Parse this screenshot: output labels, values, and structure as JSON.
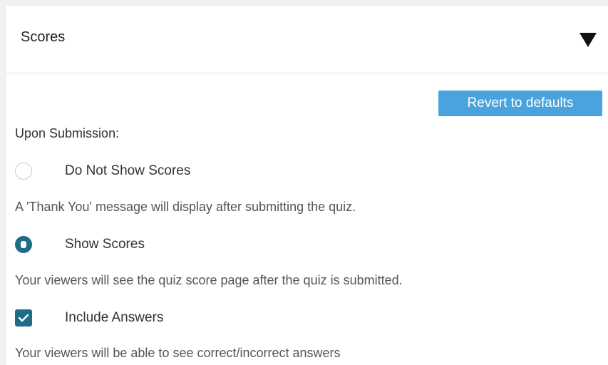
{
  "header": {
    "title": "Scores"
  },
  "actions": {
    "revert_label": "Revert to defaults"
  },
  "submission": {
    "label": "Upon Submission:",
    "options": [
      {
        "label": "Do Not Show Scores",
        "checked": false,
        "description": "A 'Thank You' message will display after submitting the quiz."
      },
      {
        "label": "Show Scores",
        "checked": true,
        "description": "Your viewers will see the quiz score page after the quiz is submitted."
      }
    ],
    "include_answers": {
      "label": "Include Answers",
      "checked": true,
      "description": "Your viewers will be able to see correct/incorrect answers"
    }
  },
  "colors": {
    "accent": "#1e6d85",
    "button": "#4aa3df"
  }
}
